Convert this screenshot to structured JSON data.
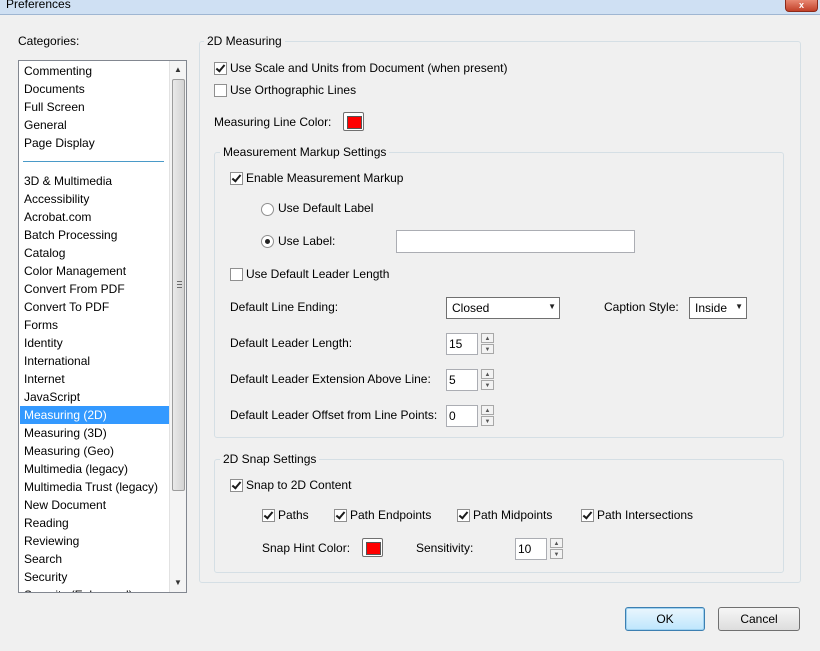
{
  "window": {
    "title": "Preferences",
    "close_glyph": "x"
  },
  "categories": {
    "label": "Categories:",
    "items": [
      "Commenting",
      "Documents",
      "Full Screen",
      "General",
      "Page Display",
      "3D & Multimedia",
      "Accessibility",
      "Acrobat.com",
      "Batch Processing",
      "Catalog",
      "Color Management",
      "Convert From PDF",
      "Convert To PDF",
      "Forms",
      "Identity",
      "International",
      "Internet",
      "JavaScript",
      "Measuring (2D)",
      "Measuring (3D)",
      "Measuring (Geo)",
      "Multimedia (legacy)",
      "Multimedia Trust (legacy)",
      "New Document",
      "Reading",
      "Reviewing",
      "Search",
      "Security",
      "Security (Enhanced)"
    ],
    "selected": "Measuring (2D)"
  },
  "measuring": {
    "legend": "2D Measuring",
    "use_scale_label": "Use Scale and Units from Document (when present)",
    "use_scale_checked": true,
    "ortho_label": "Use Orthographic Lines",
    "ortho_checked": false,
    "line_color_label": "Measuring Line Color:",
    "line_color": "#ff0000"
  },
  "markup": {
    "legend": "Measurement Markup Settings",
    "enable_label": "Enable Measurement Markup",
    "enable_checked": true,
    "default_label_option": "Use Default Label",
    "use_label_option": "Use Label:",
    "selected_option": "use_label",
    "label_value": "",
    "default_leader_label": "Use Default Leader Length",
    "default_leader_checked": false,
    "line_ending_label": "Default Line Ending:",
    "line_ending_value": "Closed",
    "caption_style_label": "Caption Style:",
    "caption_style_value": "Inside",
    "leader_length_label": "Default Leader Length:",
    "leader_length_value": "15",
    "leader_ext_label": "Default Leader Extension Above Line:",
    "leader_ext_value": "5",
    "leader_offset_label": "Default Leader Offset from Line Points:",
    "leader_offset_value": "0"
  },
  "snap": {
    "legend": "2D Snap Settings",
    "snap_content_label": "Snap to 2D Content",
    "snap_content_checked": true,
    "paths_label": "Paths",
    "endpoints_label": "Path Endpoints",
    "midpoints_label": "Path Midpoints",
    "intersections_label": "Path Intersections",
    "hint_color_label": "Snap Hint Color:",
    "hint_color": "#ff0000",
    "sensitivity_label": "Sensitivity:",
    "sensitivity_value": "10"
  },
  "buttons": {
    "ok": "OK",
    "cancel": "Cancel"
  },
  "icons": {
    "checkbox": "checkmark-icon",
    "dropdown": "chevron-down-icon",
    "spin_up": "arrow-up-icon",
    "spin_down": "arrow-down-icon"
  }
}
